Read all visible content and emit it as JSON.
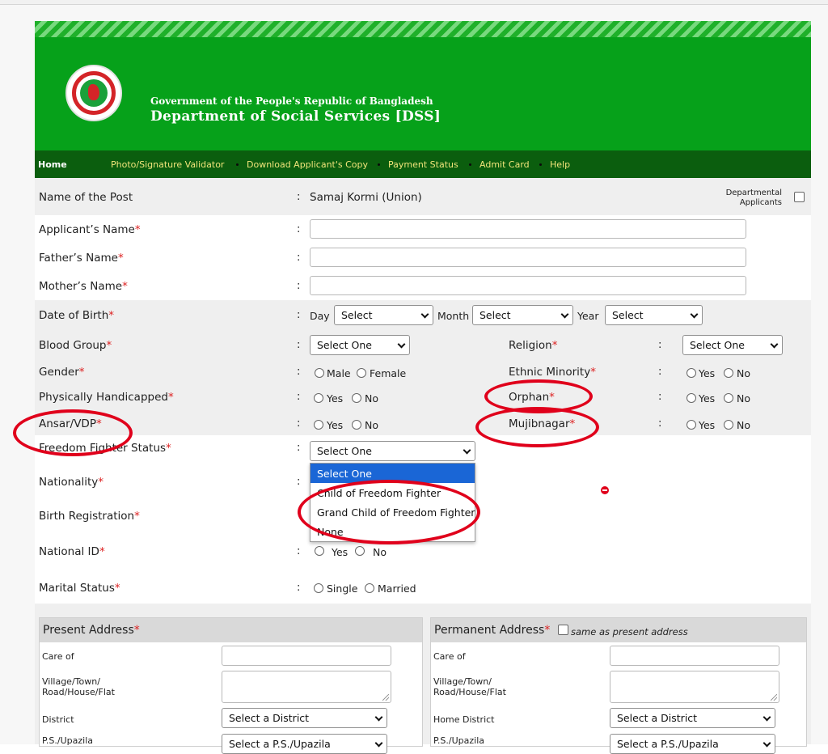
{
  "header": {
    "gov_line": "Government of the People's Republic of Bangladesh",
    "dept_line": "Department of Social Services [DSS]"
  },
  "nav": {
    "items": [
      "Home",
      "Photo/Signature Validator",
      "Download Applicant's Copy",
      "Payment Status",
      "Admit Card",
      "Help"
    ]
  },
  "form": {
    "post": {
      "label": "Name of  the Post",
      "value": "Samaj Kormi (Union)"
    },
    "departmental_label": [
      "Departmental",
      "Applicants"
    ],
    "applicant_name": {
      "label": "Applicant’s Name",
      "value": ""
    },
    "father_name": {
      "label": "Father’s Name",
      "value": ""
    },
    "mother_name": {
      "label": "Mother’s Name",
      "value": ""
    },
    "dob": {
      "label": "Date of Birth",
      "day_label": "Day",
      "month_label": "Month",
      "year_label": "Year",
      "day_value": "Select",
      "month_value": "Select",
      "year_value": "Select"
    },
    "blood_group": {
      "label": "Blood Group",
      "value": "Select One"
    },
    "religion": {
      "label": "Religion",
      "value": "Select One"
    },
    "gender": {
      "label": "Gender",
      "options": [
        "Male",
        "Female"
      ]
    },
    "ethnic_minority": {
      "label": "Ethnic Minority",
      "options": [
        "Yes",
        "No"
      ]
    },
    "physically_handicapped": {
      "label": "Physically Handicapped",
      "options": [
        "Yes",
        "No"
      ]
    },
    "orphan": {
      "label": "Orphan",
      "options": [
        "Yes",
        "No"
      ]
    },
    "ansar_vdp": {
      "label": "Ansar/VDP",
      "options": [
        "Yes",
        "No"
      ]
    },
    "mujibnagar": {
      "label": "Mujibnagar",
      "options": [
        "Yes",
        "No"
      ]
    },
    "freedom_fighter": {
      "label": "Freedom Fighter Status",
      "value": "Select One",
      "options": [
        "Select One",
        "Child of Freedom Fighter",
        "Grand Child of Freedom Fighter",
        "None"
      ]
    },
    "nationality": {
      "label": "Nationality"
    },
    "birth_registration": {
      "label": "Birth Registration"
    },
    "national_id": {
      "label": "National ID",
      "options": [
        "Yes",
        "No"
      ]
    },
    "marital_status": {
      "label": "Marital Status",
      "options": [
        "Single",
        "Married"
      ]
    },
    "required_mark": "*",
    "colon": ":"
  },
  "present_address": {
    "title": "Present Address",
    "care_of": "Care of",
    "village": [
      "Village/Town/",
      "Road/House/Flat"
    ],
    "district": "District",
    "district_value": "Select a District",
    "ps": "P.S./Upazila",
    "ps_value": "Select a P.S./Upazila"
  },
  "permanent_address": {
    "title": "Permanent Address",
    "same_label": "same as present address",
    "care_of": "Care of",
    "village": [
      "Village/Town/",
      "Road/House/Flat"
    ],
    "district": "Home District",
    "district_value": "Select a District",
    "ps": "P.S./Upazila",
    "ps_value": "Select a P.S./Upazila"
  },
  "colors": {
    "header_green": "#06a11a",
    "nav_green": "#0b5e0e",
    "link_yellow": "#f0e47a",
    "required_red": "#dd2222",
    "annotation_red": "#e0001b",
    "dropdown_highlight": "#1a66d6"
  }
}
